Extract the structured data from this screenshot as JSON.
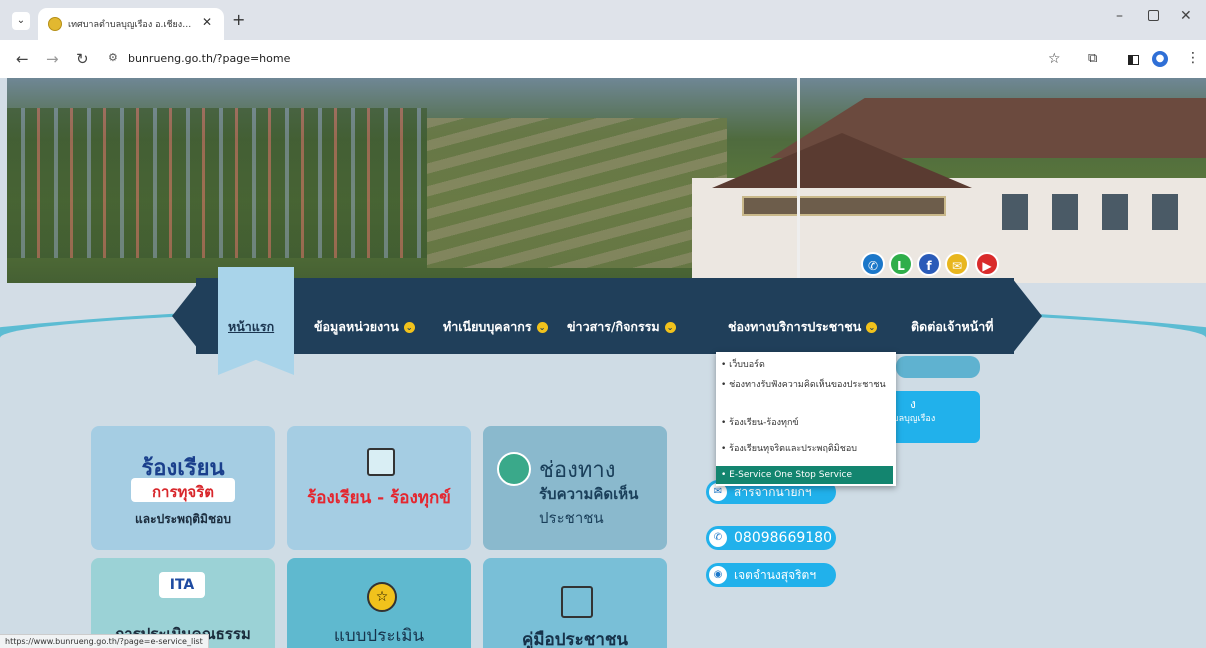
{
  "browser": {
    "tab_title": "เทศบาลตำบลบุญเรือง อ.เชียงของ จ.เชียงราย",
    "url": "bunrueng.go.th/?page=home",
    "status_url": "https://www.bunrueng.go.th/?page=e-service_list"
  },
  "nav": {
    "home": "หน้าแรก",
    "items": [
      "ข้อมูลหน่วยงาน",
      "ทำเนียบบุคลากร",
      "ข่าวสาร/กิจกรรม",
      "ช่องทางบริการประชาชน",
      "ติดต่อเจ้าหน้าที่"
    ]
  },
  "dropdown": {
    "items": [
      "• เว็บบอร์ด",
      "• ช่องทางรับฟังความคิดเห็นของประชาชน",
      "• ร้องเรียน-ร้องทุกข์",
      "• ร้องเรียนทุจริตและประพฤติมิชอบ",
      "• E-Service One Stop Service"
    ]
  },
  "info_card": {
    "line1": "ง",
    "line2": "ตำบลบุญเรือง"
  },
  "tiles": {
    "t1": {
      "line1": "ร้องเรียน",
      "line2": "การทุจริต",
      "line3": "และประพฤติมิชอบ"
    },
    "t2": {
      "text": "ร้องเรียน - ร้องทุกข์"
    },
    "t3": {
      "line1": "ช่องทาง",
      "line2": "รับความคิดเห็น",
      "line3": "ประชาชน"
    },
    "t4": {
      "logo": "ITA",
      "text": "การประเมินคุณธรรม"
    },
    "t5": {
      "text": "แบบประเมิน"
    },
    "t6": {
      "text": "คู่มือประชาชน"
    }
  },
  "pills": {
    "p1": "สารจากนายกฯ",
    "p2": "08098669180",
    "p3": "เจตจำนงสุจริตฯ"
  },
  "colors": {
    "nav_bg": "#203f5a",
    "accent": "#21b1eb",
    "active_dd": "#13856f"
  }
}
